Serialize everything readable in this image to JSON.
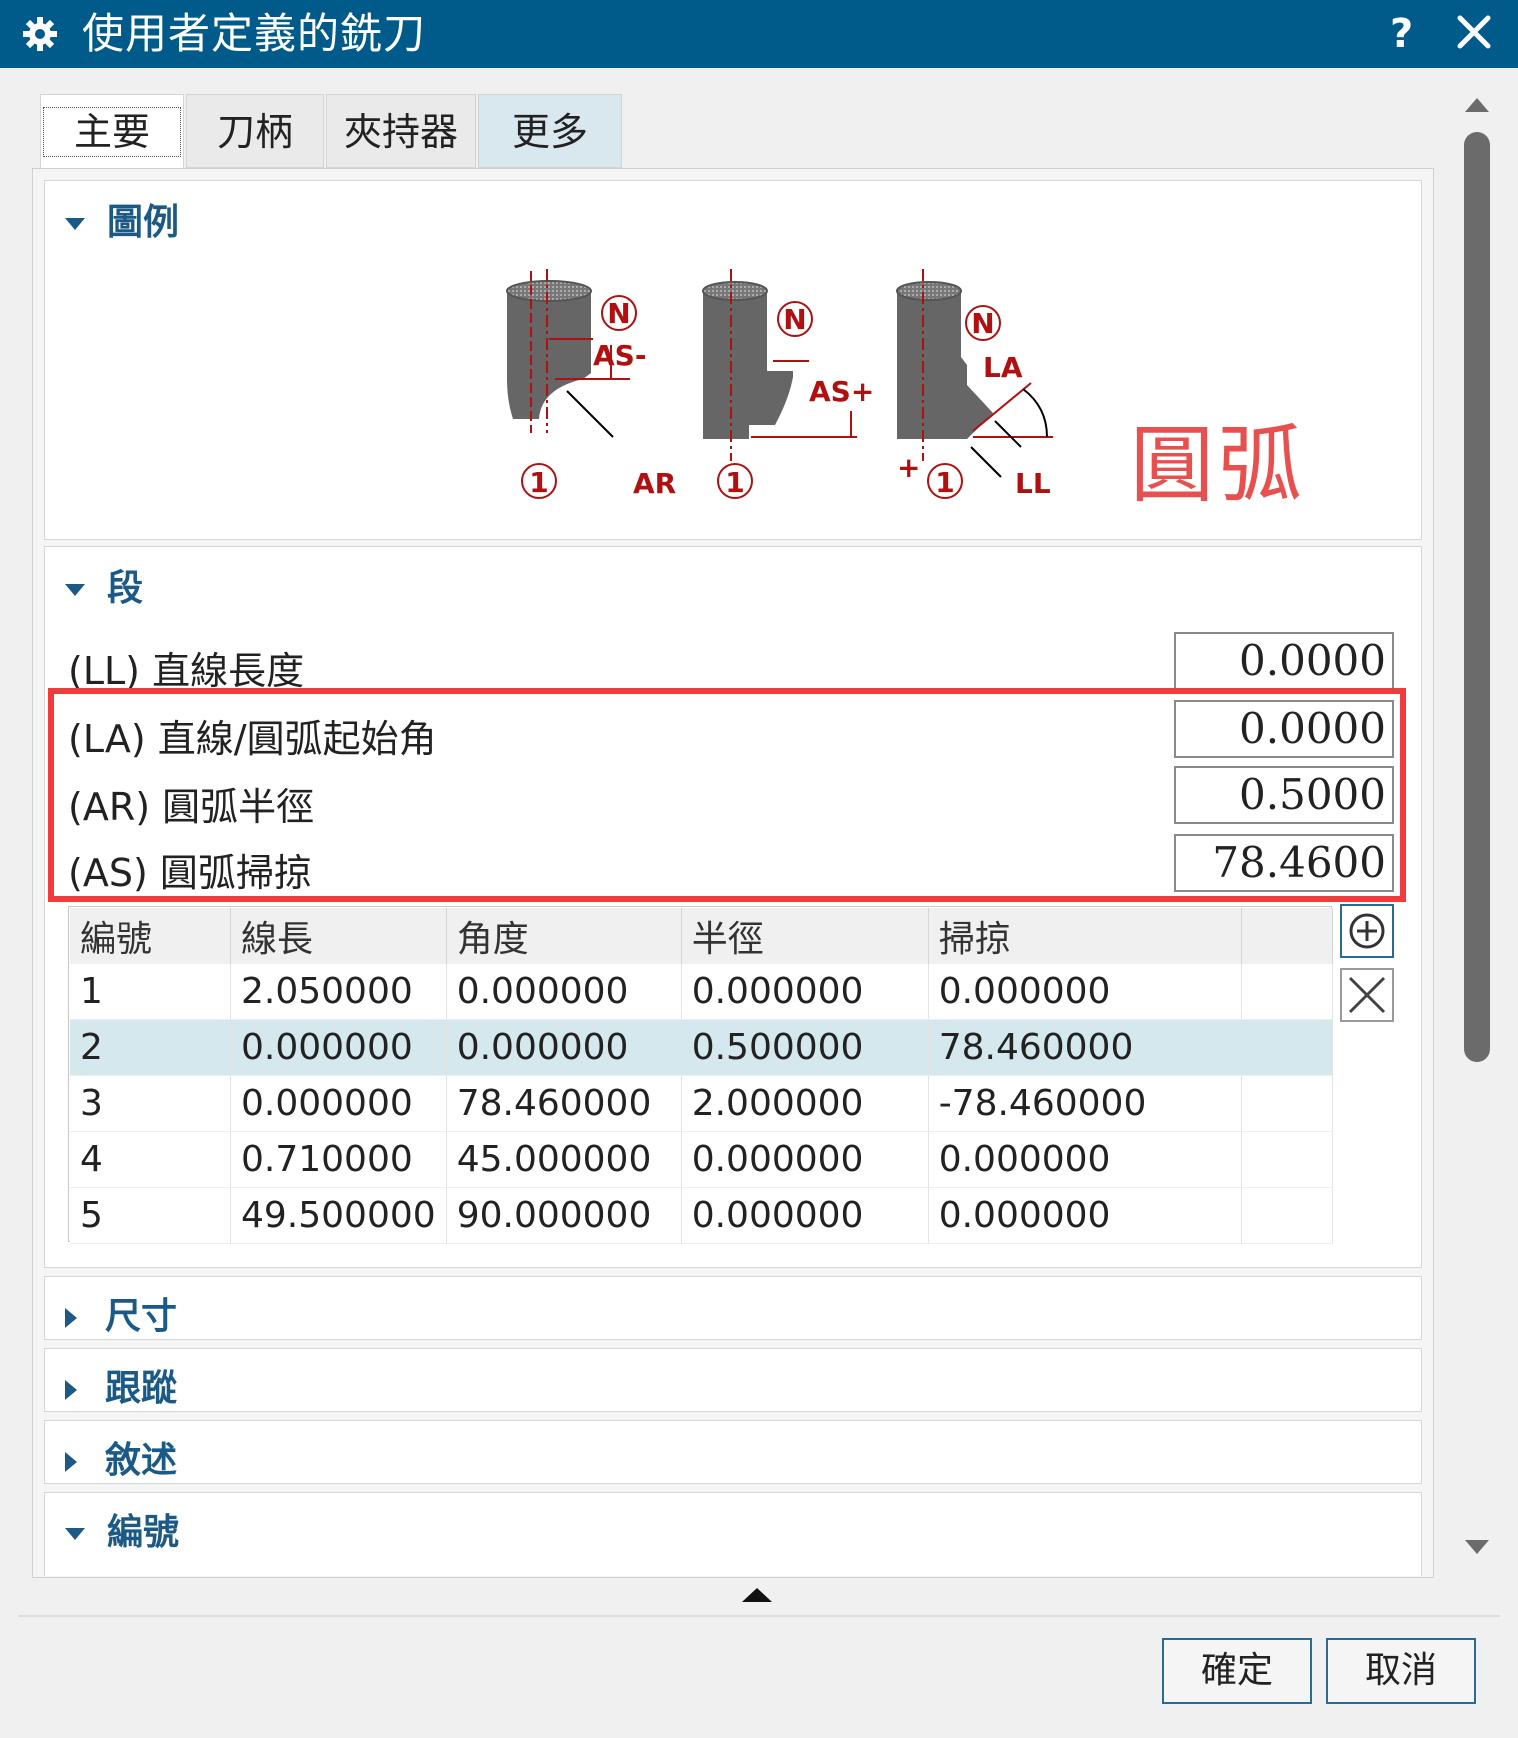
{
  "dialog": {
    "title": "使用者定義的銑刀",
    "help": "?"
  },
  "tabs": [
    {
      "label": "主要",
      "active": true
    },
    {
      "label": "刀柄",
      "active": false
    },
    {
      "label": "夾持器",
      "active": false
    },
    {
      "label": "更多",
      "active": false
    }
  ],
  "legend_group": {
    "title": "圖例",
    "diagram_labels": {
      "n": "N",
      "one": "1",
      "as_minus": "AS-",
      "as_plus": "AS+",
      "ar": "AR",
      "la": "LA",
      "ll": "LL",
      "plus": "+"
    },
    "annotation": "圓弧"
  },
  "segment_group": {
    "title": "段",
    "fields": [
      {
        "label": "(LL) 直線長度",
        "value": "0.0000"
      },
      {
        "label": "(LA) 直線/圓弧起始角",
        "value": "0.0000"
      },
      {
        "label": "(AR) 圓弧半徑",
        "value": "0.5000"
      },
      {
        "label": "(AS) 圓弧掃掠",
        "value": "78.4600"
      }
    ],
    "table": {
      "columns": [
        "編號",
        "線長",
        "角度",
        "半徑",
        "掃掠"
      ],
      "rows": [
        [
          "1",
          "2.050000",
          "0.000000",
          "0.000000",
          "0.000000"
        ],
        [
          "2",
          "0.000000",
          "0.000000",
          "0.500000",
          "78.460000"
        ],
        [
          "3",
          "0.000000",
          "78.460000",
          "2.000000",
          "-78.460000"
        ],
        [
          "4",
          "0.710000",
          "45.000000",
          "0.000000",
          "0.000000"
        ],
        [
          "5",
          "49.500000",
          "90.000000",
          "0.000000",
          "0.000000"
        ]
      ],
      "selected_row": 2
    }
  },
  "collapsed_groups": [
    {
      "title": "尺寸"
    },
    {
      "title": "跟蹤"
    },
    {
      "title": "敘述"
    }
  ],
  "numbering_group": {
    "title": "編號"
  },
  "buttons": {
    "ok": "確定",
    "cancel": "取消"
  },
  "colors": {
    "titlebar": "#005b8a",
    "accent": "#1b5a86",
    "highlight": "#f03c3c",
    "selected_row": "#d5e8ee"
  }
}
